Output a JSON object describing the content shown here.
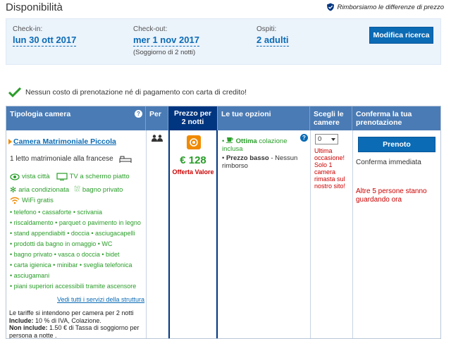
{
  "header": {
    "title": "Disponibilità",
    "price_match": "Rimborsiamo le differenze di prezzo"
  },
  "search": {
    "checkin_label": "Check-in:",
    "checkin_value": "lun 30 ott 2017",
    "checkout_label": "Check-out:",
    "checkout_value": "mer 1 nov 2017",
    "stay_note": "(Soggiorno di 2 notti)",
    "guests_label": "Ospiti:",
    "guests_value": "2 adulti",
    "modify_button": "Modifica ricerca"
  },
  "no_fee_notice": "Nessun costo di prenotazione né di pagamento con carta di credito!",
  "table": {
    "headers": {
      "room_type": "Tipologia camera",
      "per": "Per",
      "price": "Prezzo per 2 notti",
      "options": "Le tue opzioni",
      "choose": "Scegli le camere",
      "confirm": "Conferma la tua prenotazione"
    },
    "room": {
      "name": "Camera Matrimoniale Piccola",
      "bed": "1 letto matrimoniale alla francese",
      "amenities": [
        "vista città",
        "TV a schermo piatto",
        "aria condizionata",
        "bagno privato",
        "WiFi gratis"
      ],
      "features_lines": [
        "• telefono  • cassaforte  • scrivania",
        "• riscaldamento  • parquet o pavimento in legno",
        "• stand appendiabiti  • doccia  • asciugacapelli",
        "• prodotti da bagno in omaggio  • WC",
        "• bagno privato  • vasca o doccia  • bidet",
        "• carta igienica  • minibar  • sveglia telefonica",
        "• asciugamani",
        "• piani superiori accessibili tramite ascensore"
      ],
      "all_services_link": "Vedi tutti i servizi della struttura",
      "rates_note_1": "Le tariffe si intendono per camera per 2 notti",
      "rates_include_label": "Include:",
      "rates_include": " 10 % di IVA, Colazione.",
      "rates_exclude_label": "Non include:",
      "rates_exclude": " 1.50 € di Tassa di soggiorno per persona a notte ."
    },
    "price": {
      "value": "€ 128",
      "label": "Offerta Valore"
    },
    "options": {
      "breakfast_bold": "Ottima",
      "breakfast_rest": " colazione inclusa",
      "price_bold": "Prezzo basso",
      "price_rest": " - Nessun rimborso"
    },
    "choose": {
      "selected": "0",
      "scarcity": "Ultima occasione! Solo 1 camera rimasta sul nostro sito!"
    },
    "confirm": {
      "book_button": "Prenoto",
      "instant": "Conferma immediata",
      "watching": "Altre 5 persone stanno guardando ora"
    }
  }
}
